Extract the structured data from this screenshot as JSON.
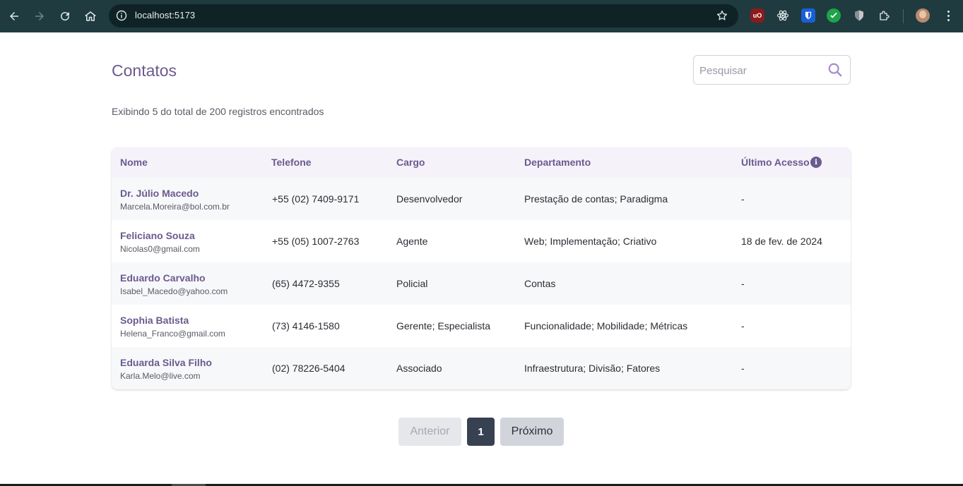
{
  "browser": {
    "url": "localhost:5173",
    "colors": {
      "toolbar": "#1f3b40",
      "omnibox": "#0f2327"
    },
    "extensions": [
      {
        "name": "ublock-icon",
        "label": "uO",
        "color": "#8b1a1a"
      },
      {
        "name": "react-devtools-icon",
        "label": "",
        "color": "#1f3b40"
      },
      {
        "name": "bitwarden-icon",
        "label": "",
        "color": "#1a5fd8"
      },
      {
        "name": "check-extension-icon",
        "label": "",
        "color": "#1fa34a"
      },
      {
        "name": "shield-extension-icon",
        "label": "",
        "color": "#8a8f93"
      },
      {
        "name": "puzzle-icon",
        "label": "",
        "color": "#1f3b40"
      }
    ]
  },
  "page": {
    "title": "Contatos",
    "subtitle": "Exibindo 5 do total de 200 registros encontrados"
  },
  "search": {
    "placeholder": "Pesquisar",
    "value": ""
  },
  "table": {
    "headers": {
      "name": "Nome",
      "phone": "Telefone",
      "role": "Cargo",
      "department": "Departamento",
      "last_access": "Último Acesso"
    },
    "rows": [
      {
        "name": "Dr. Júlio Macedo",
        "email": "Marcela.Moreira@bol.com.br",
        "phone": "+55 (02) 7409-9171",
        "role": "Desenvolvedor",
        "department": "Prestação de contas; Paradigma",
        "last_access": "-"
      },
      {
        "name": "Feliciano Souza",
        "email": "Nicolas0@gmail.com",
        "phone": "+55 (05) 1007-2763",
        "role": "Agente",
        "department": "Web; Implementação; Criativo",
        "last_access": "18 de fev. de 2024"
      },
      {
        "name": "Eduardo Carvalho",
        "email": "Isabel_Macedo@yahoo.com",
        "phone": "(65) 4472-9355",
        "role": "Policial",
        "department": "Contas",
        "last_access": "-"
      },
      {
        "name": "Sophia Batista",
        "email": "Helena_Franco@gmail.com",
        "phone": "(73) 4146-1580",
        "role": "Gerente; Especialista",
        "department": "Funcionalidade; Mobilidade; Métricas",
        "last_access": "-"
      },
      {
        "name": "Eduarda Silva Filho",
        "email": "Karla.Melo@live.com",
        "phone": "(02) 78226-5404",
        "role": "Associado",
        "department": "Infraestrutura; Divisão; Fatores",
        "last_access": "-"
      }
    ]
  },
  "pagination": {
    "prev_label": "Anterior",
    "current_page": "1",
    "next_label": "Próximo"
  },
  "colors": {
    "accent": "#6b5a8e",
    "header_bg": "#f5f2fa",
    "row_alt_bg": "#f7f8fa",
    "active_page_bg": "#374151"
  }
}
